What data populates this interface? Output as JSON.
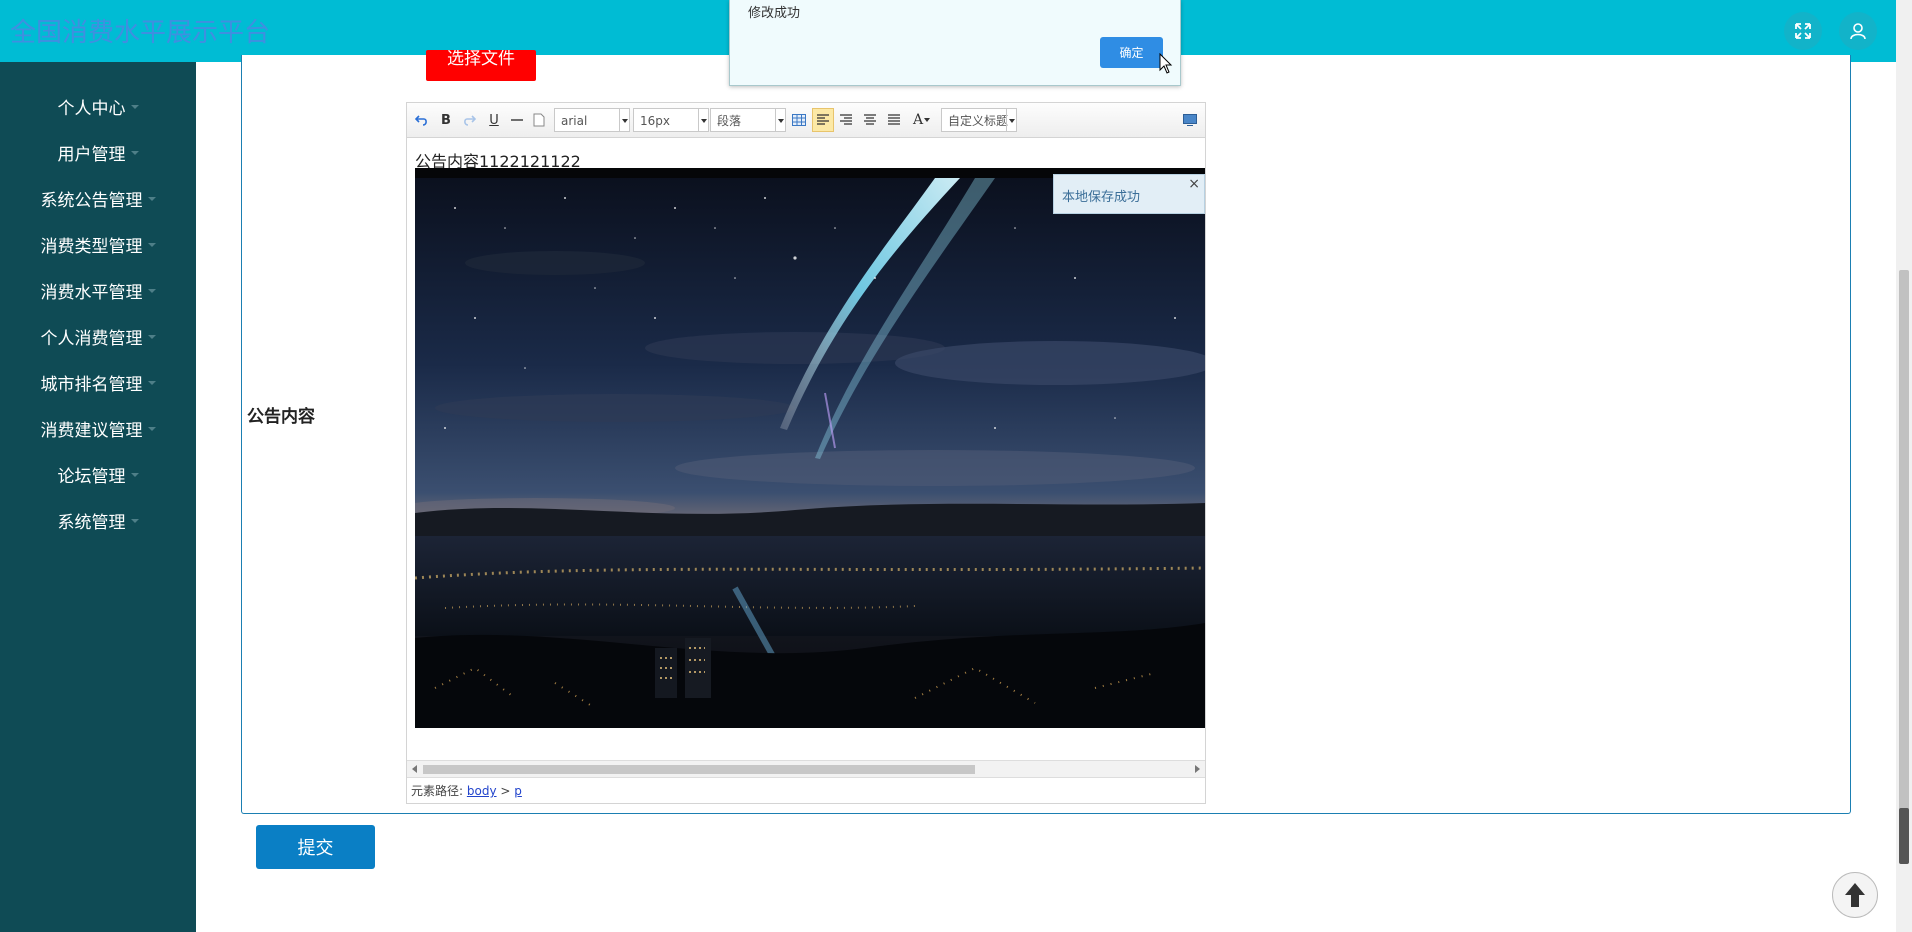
{
  "app": {
    "title": "全国消费水平展示平台"
  },
  "header": {
    "fullscreen_icon": "expand-icon",
    "user_icon": "user-icon"
  },
  "sidebar": {
    "items": [
      {
        "label": "个人中心"
      },
      {
        "label": "用户管理"
      },
      {
        "label": "系统公告管理"
      },
      {
        "label": "消费类型管理"
      },
      {
        "label": "消费水平管理"
      },
      {
        "label": "个人消费管理"
      },
      {
        "label": "城市排名管理"
      },
      {
        "label": "消费建议管理"
      },
      {
        "label": "论坛管理"
      },
      {
        "label": "系统管理"
      }
    ]
  },
  "form": {
    "choose_file_label": "选择文件",
    "content_label": "公告内容",
    "submit_label": "提交"
  },
  "editor": {
    "font_family": "arial",
    "font_size": "16px",
    "paragraph": "段落",
    "custom_title": "自定义标题",
    "content_text": "公告内容1122121122",
    "toast_text": "本地保存成功",
    "toast_close": "×",
    "path_label": "元素路径:",
    "path_body": "body",
    "path_sep": ">",
    "path_p": "p",
    "toolbar_labels": {
      "bold": "B",
      "underline": "U",
      "font_color": "A"
    }
  },
  "dialog": {
    "message": "修改成功",
    "ok_label": "确定"
  },
  "colors": {
    "topbar": "#00bcd4",
    "sidebar": "#0f4b55",
    "submit": "#0a7fc5",
    "choose_file": "#ff0000",
    "dialog_ok": "#2f8de4"
  }
}
